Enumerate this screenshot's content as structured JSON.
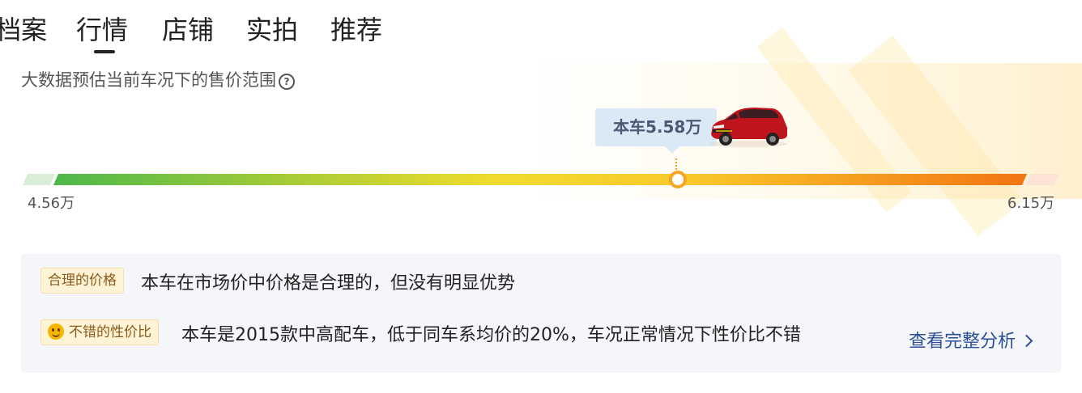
{
  "tabs": [
    {
      "label": "档案",
      "active": false
    },
    {
      "label": "行情",
      "active": true
    },
    {
      "label": "店铺",
      "active": false
    },
    {
      "label": "实拍",
      "active": false
    },
    {
      "label": "推荐",
      "active": false
    }
  ],
  "price_section": {
    "title": "大数据预估当前车况下的售价范围",
    "help_icon": "question-circle-icon",
    "current_price_label": "本车5.58万",
    "min_price_label": "4.56万",
    "max_price_label": "6.15万",
    "current_price_position": 0.625,
    "bar_colors": [
      "#d7ecd3",
      "#4cb84a",
      "#c7d43a",
      "#f9dc3a",
      "#f8b12c",
      "#f27a12",
      "#fde3d6"
    ]
  },
  "assessment": {
    "items": [
      {
        "tag": "合理的价格",
        "text": "本车在市场价中价格是合理的，但没有明显优势",
        "icon": null
      },
      {
        "tag": "不错的性价比",
        "text": "本车是2015款中高配车，低于同车系均价的20%，车况正常情况下性价比不错",
        "icon": "smile-emoji-icon"
      }
    ],
    "link_label": "查看完整分析"
  },
  "colors": {
    "accent_link": "#2b4e96",
    "bubble_bg": "#dbe8f6",
    "tag_bg": "#fff3d6",
    "card_bg": "#f4f6f9"
  }
}
